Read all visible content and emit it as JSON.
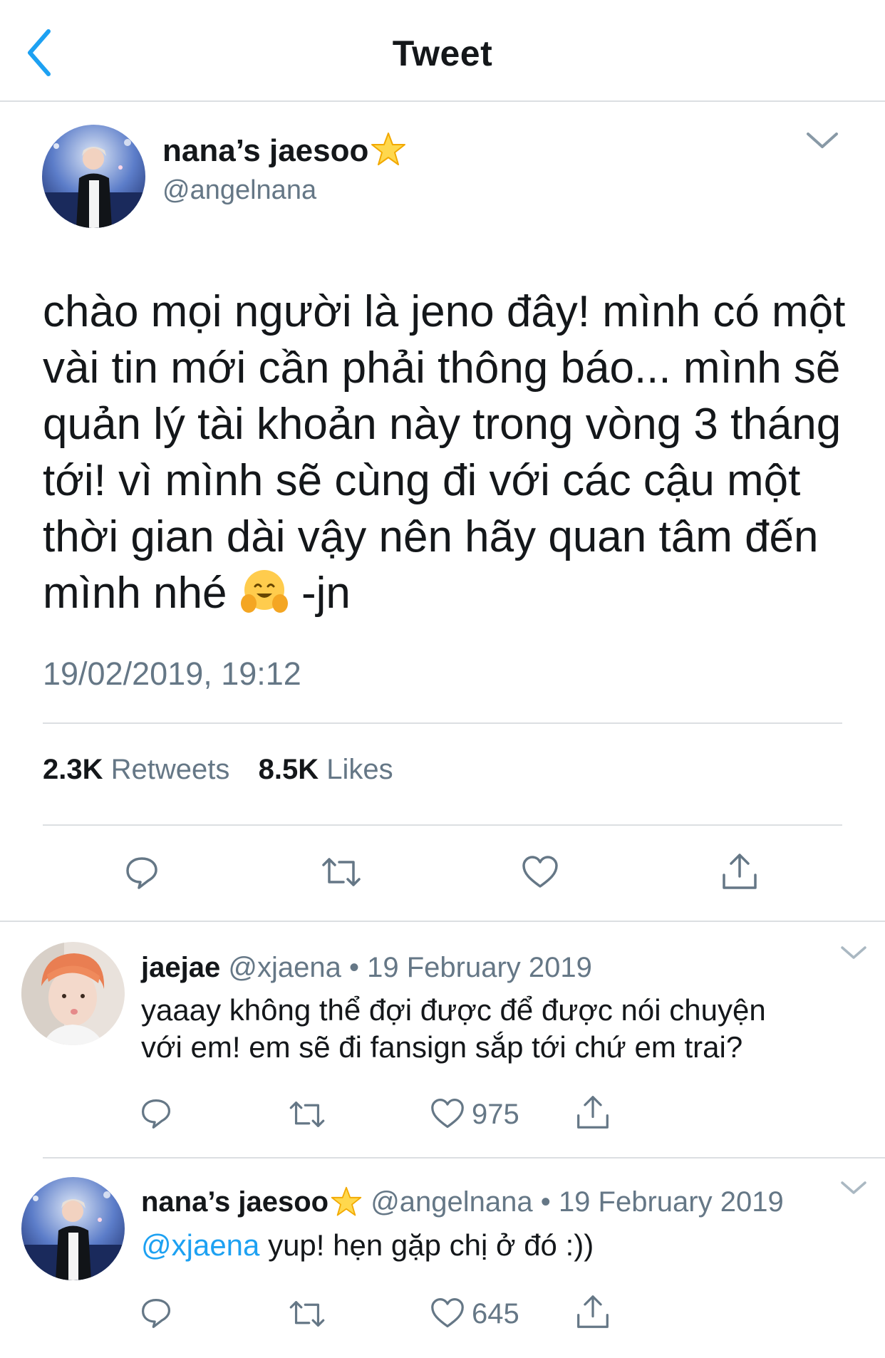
{
  "header": {
    "title": "Tweet",
    "back_icon": "chevron-left-icon"
  },
  "colors": {
    "accent": "#1da1f2",
    "muted": "#657786",
    "text": "#14171a",
    "divider": "#dcdfe2"
  },
  "tweet": {
    "author": {
      "name": "nana’s jaesoo",
      "handle": "@angelnana",
      "badge_icon": "star-emoji"
    },
    "text_before_emoji": "chào mọi người là jeno đây! mình có một vài tin mới cần phải thông báo... mình sẽ quản lý tài khoản này trong vòng 3 tháng tới! vì mình sẽ cùng đi với các cậu một thời gian dài vậy nên hãy quan tâm đến mình nhé",
    "emoji_icon": "hugging-face-emoji",
    "text_after_emoji": "-jn",
    "timestamp": "19/02/2019, 19:12",
    "stats": {
      "retweets_count": "2.3K",
      "retweets_label": "Retweets",
      "likes_count": "8.5K",
      "likes_label": "Likes"
    },
    "actions": [
      "reply-icon",
      "retweet-icon",
      "like-icon",
      "share-icon"
    ]
  },
  "replies": [
    {
      "name": "jaejae",
      "handle": "@xjaena",
      "separator": "•",
      "date": "19 February 2019",
      "line1": "yaaay không thể đợi được để được nói chuyện",
      "line2": "với em! em sẽ đi fansign sắp tới chứ em trai?",
      "likes": "975"
    },
    {
      "name": "nana’s jaesoo",
      "handle": "@angelnana",
      "separator": "•",
      "date": "19 February 2019",
      "mention": "@xjaena",
      "text": "yup! hẹn gặp chị ở đó :))",
      "likes": "645"
    }
  ]
}
